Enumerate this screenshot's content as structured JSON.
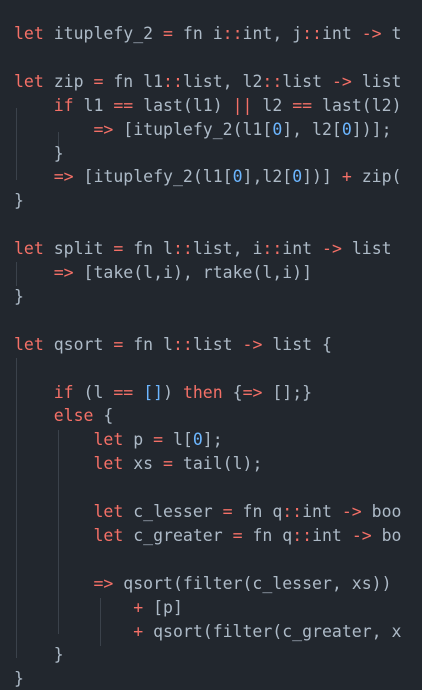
{
  "editor": {
    "theme": {
      "background": "#22272e",
      "text": "#adbac7",
      "keyword": "#f47067",
      "operator": "#f47067",
      "number": "#6cb6ff",
      "indent_guide": "#3b424b"
    },
    "lines": [
      [
        [
          "kw",
          "let"
        ],
        [
          "pl",
          " ituplefy_2 "
        ],
        [
          "op",
          "="
        ],
        [
          "pl",
          " fn i"
        ],
        [
          "op",
          "::"
        ],
        [
          "pl",
          "int, j"
        ],
        [
          "op",
          "::"
        ],
        [
          "pl",
          "int "
        ],
        [
          "op",
          "->"
        ],
        [
          "pl",
          " t"
        ]
      ],
      [],
      [
        [
          "kw",
          "let"
        ],
        [
          "pl",
          " zip "
        ],
        [
          "op",
          "="
        ],
        [
          "pl",
          " fn l1"
        ],
        [
          "op",
          "::"
        ],
        [
          "pl",
          "list, l2"
        ],
        [
          "op",
          "::"
        ],
        [
          "pl",
          "list "
        ],
        [
          "op",
          "->"
        ],
        [
          "pl",
          " list"
        ]
      ],
      [
        [
          "pl",
          "    "
        ],
        [
          "kw",
          "if"
        ],
        [
          "pl",
          " l1 "
        ],
        [
          "op",
          "=="
        ],
        [
          "pl",
          " last(l1) "
        ],
        [
          "op",
          "||"
        ],
        [
          "pl",
          " l2 "
        ],
        [
          "op",
          "=="
        ],
        [
          "pl",
          " last(l2)"
        ]
      ],
      [
        [
          "pl",
          "        "
        ],
        [
          "op",
          "=>"
        ],
        [
          "pl",
          " [ituplefy_2(l1["
        ],
        [
          "num",
          "0"
        ],
        [
          "pl",
          "], l2["
        ],
        [
          "num",
          "0"
        ],
        [
          "pl",
          "])];"
        ]
      ],
      [
        [
          "pl",
          "    }"
        ]
      ],
      [
        [
          "pl",
          "    "
        ],
        [
          "op",
          "=>"
        ],
        [
          "pl",
          " [ituplefy_2(l1["
        ],
        [
          "num",
          "0"
        ],
        [
          "pl",
          "],l2["
        ],
        [
          "num",
          "0"
        ],
        [
          "pl",
          "])] "
        ],
        [
          "op",
          "+"
        ],
        [
          "pl",
          " zip("
        ]
      ],
      [
        [
          "pl",
          "}"
        ]
      ],
      [],
      [
        [
          "kw",
          "let"
        ],
        [
          "pl",
          " split "
        ],
        [
          "op",
          "="
        ],
        [
          "pl",
          " fn l"
        ],
        [
          "op",
          "::"
        ],
        [
          "pl",
          "list, i"
        ],
        [
          "op",
          "::"
        ],
        [
          "pl",
          "int "
        ],
        [
          "op",
          "->"
        ],
        [
          "pl",
          " list"
        ]
      ],
      [
        [
          "pl",
          "    "
        ],
        [
          "op",
          "=>"
        ],
        [
          "pl",
          " [take(l,i), rtake(l,i)]"
        ]
      ],
      [
        [
          "pl",
          "}"
        ]
      ],
      [],
      [
        [
          "kw",
          "let"
        ],
        [
          "pl",
          " qsort "
        ],
        [
          "op",
          "="
        ],
        [
          "pl",
          " fn l"
        ],
        [
          "op",
          "::"
        ],
        [
          "pl",
          "list "
        ],
        [
          "op",
          "->"
        ],
        [
          "pl",
          " list {"
        ]
      ],
      [],
      [
        [
          "pl",
          "    "
        ],
        [
          "kw",
          "if"
        ],
        [
          "pl",
          " (l "
        ],
        [
          "op",
          "=="
        ],
        [
          "pl",
          " "
        ],
        [
          "num",
          "[]"
        ],
        [
          "pl",
          ") "
        ],
        [
          "kw",
          "then"
        ],
        [
          "pl",
          " {"
        ],
        [
          "op",
          "=>"
        ],
        [
          "pl",
          " [];}"
        ]
      ],
      [
        [
          "pl",
          "    "
        ],
        [
          "kw",
          "else"
        ],
        [
          "pl",
          " {"
        ]
      ],
      [
        [
          "pl",
          "        "
        ],
        [
          "kw",
          "let"
        ],
        [
          "pl",
          " p "
        ],
        [
          "op",
          "="
        ],
        [
          "pl",
          " l["
        ],
        [
          "num",
          "0"
        ],
        [
          "pl",
          "];"
        ]
      ],
      [
        [
          "pl",
          "        "
        ],
        [
          "kw",
          "let"
        ],
        [
          "pl",
          " xs "
        ],
        [
          "op",
          "="
        ],
        [
          "pl",
          " tail(l);"
        ]
      ],
      [],
      [
        [
          "pl",
          "        "
        ],
        [
          "kw",
          "let"
        ],
        [
          "pl",
          " c_lesser "
        ],
        [
          "op",
          "="
        ],
        [
          "pl",
          " fn q"
        ],
        [
          "op",
          "::"
        ],
        [
          "pl",
          "int "
        ],
        [
          "op",
          "->"
        ],
        [
          "pl",
          " boo"
        ]
      ],
      [
        [
          "pl",
          "        "
        ],
        [
          "kw",
          "let"
        ],
        [
          "pl",
          " c_greater "
        ],
        [
          "op",
          "="
        ],
        [
          "pl",
          " fn q"
        ],
        [
          "op",
          "::"
        ],
        [
          "pl",
          "int "
        ],
        [
          "op",
          "->"
        ],
        [
          "pl",
          " bo"
        ]
      ],
      [],
      [
        [
          "pl",
          "        "
        ],
        [
          "op",
          "=>"
        ],
        [
          "pl",
          " qsort(filter(c_lesser, xs))"
        ]
      ],
      [
        [
          "pl",
          "            "
        ],
        [
          "op",
          "+"
        ],
        [
          "pl",
          " [p]"
        ]
      ],
      [
        [
          "pl",
          "            "
        ],
        [
          "op",
          "+"
        ],
        [
          "pl",
          " qsort(filter(c_greater, x"
        ]
      ],
      [
        [
          "pl",
          "    }"
        ]
      ],
      [
        [
          "pl",
          "}"
        ]
      ]
    ]
  }
}
